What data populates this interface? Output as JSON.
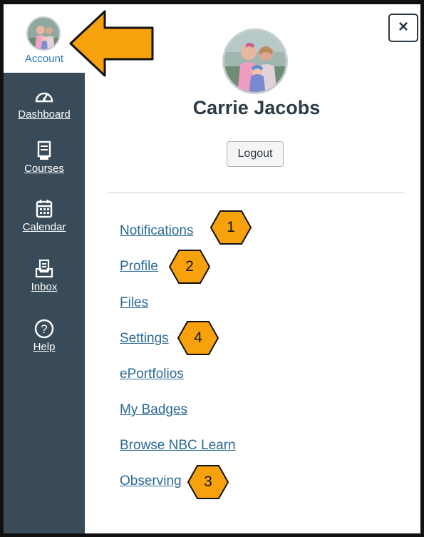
{
  "window": {
    "close_label": "×"
  },
  "sidebar": {
    "account_label": "Account",
    "items": [
      {
        "label": "Dashboard",
        "icon": "dashboard-gauge-icon"
      },
      {
        "label": "Courses",
        "icon": "courses-book-icon"
      },
      {
        "label": "Calendar",
        "icon": "calendar-icon"
      },
      {
        "label": "Inbox",
        "icon": "inbox-tray-icon"
      },
      {
        "label": "Help",
        "icon": "help-question-icon"
      }
    ]
  },
  "profile": {
    "name": "Carrie Jacobs",
    "logout_label": "Logout"
  },
  "menu": [
    {
      "label": "Notifications"
    },
    {
      "label": "Profile"
    },
    {
      "label": "Files"
    },
    {
      "label": "Settings"
    },
    {
      "label": "ePortfolios"
    },
    {
      "label": "My Badges"
    },
    {
      "label": "Browse NBC Learn"
    },
    {
      "label": "Observing"
    }
  ],
  "callouts": [
    {
      "number": "1",
      "target": "Notifications"
    },
    {
      "number": "2",
      "target": "Profile"
    },
    {
      "number": "4",
      "target": "Settings"
    },
    {
      "number": "3",
      "target": "Observing"
    }
  ],
  "colors": {
    "sidebar": "#394b58",
    "link": "#2b6a94",
    "account_label": "#2b7abc",
    "callout_fill": "#f7a20c",
    "text": "#2d3b45"
  }
}
